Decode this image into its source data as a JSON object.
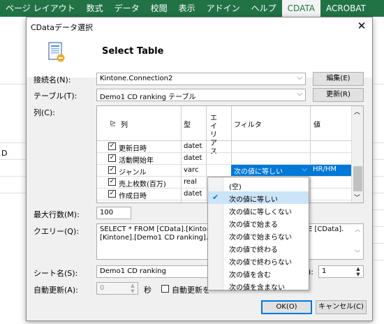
{
  "ribbon": {
    "tabs": [
      "ページ レイアウト",
      "数式",
      "データ",
      "校閲",
      "表示",
      "アドイン",
      "ヘルプ",
      "CDATA",
      "ACROBAT"
    ],
    "active_tab": "CDATA"
  },
  "sheet": {
    "column_letter": "D"
  },
  "dialog": {
    "title": "CDataデータ選択",
    "close": "✕",
    "header_title": "Select Table",
    "connection": {
      "label": "接続名(N):",
      "value": "Kintone.Connection2",
      "edit_button": "編集(E)"
    },
    "table": {
      "label": "テーブル(T):",
      "value": "Demo1 CD ranking テーブル",
      "refresh_button": "更新(R)"
    },
    "columns": {
      "label": "列(C):",
      "headers": {
        "column": "列",
        "type": "型",
        "alias": "エイリアス",
        "filter": "フィルタ",
        "value": "値"
      },
      "rows": [
        {
          "name": "更新日時",
          "type": "datet",
          "checked": true
        },
        {
          "name": "活動開始年",
          "type": "datet",
          "checked": true
        },
        {
          "name": "ジャンル",
          "type": "varc",
          "checked": true,
          "filter": "次の値に等しい",
          "value": "HR/HM"
        },
        {
          "name": "売上枚数(百万)",
          "type": "real",
          "checked": true
        },
        {
          "name": "作成日時",
          "type": "datet",
          "checked": true
        }
      ]
    },
    "max_rows": {
      "label": "最大行数(M):",
      "value": "100"
    },
    "query": {
      "label": "クエリー(Q):",
      "line1": "SELECT * FROM [CData].[Kinton",
      "line1_tail": "E [CData].",
      "line2": "[Kintone].[Demo1 CD ranking].[S"
    },
    "sheet_name": {
      "label": "シート名(S):",
      "value": "Demo1 CD ranking",
      "tail_label": "):",
      "tail_value": "1"
    },
    "auto_update": {
      "label": "自動更新(A):",
      "value": "0",
      "unit": "秒",
      "checkbox_label": "自動更新を"
    },
    "ok_button": "OK(O)",
    "cancel_button": "キャンセル(C)",
    "filter_dropdown": {
      "selected": "次の値に等しい",
      "options": [
        "(空)",
        "次の値に等しい",
        "次の値に等しくない",
        "次の値で始まる",
        "次の値で始まらない",
        "次の値で終わる",
        "次の値で終わらない",
        "次の値を含む",
        "次の値を含まない"
      ]
    }
  },
  "colors": {
    "ribbon": "#217346",
    "selection": "#0078d7",
    "dialog_bg": "#f0f0f0"
  }
}
